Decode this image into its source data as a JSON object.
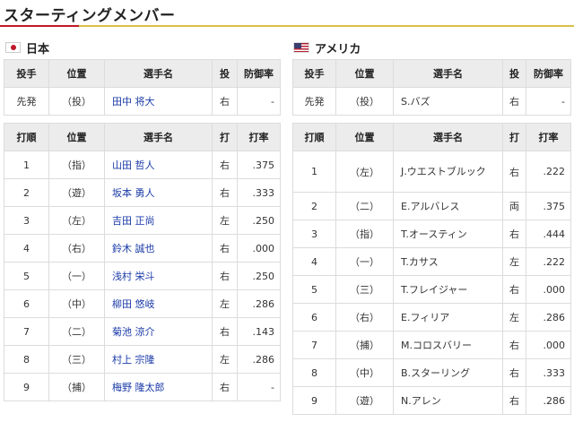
{
  "page": {
    "title": "スターティングメンバー"
  },
  "japan": {
    "team_name": "日本",
    "flag_icon": "japan-flag-icon",
    "pitcher_headers": [
      "投手",
      "位置",
      "選手名",
      "投",
      "防御率"
    ],
    "pitcher": {
      "role": "先発",
      "pos": "（投）",
      "name": "田中 将大",
      "hand": "右",
      "era": "-"
    },
    "batting_headers": [
      "打順",
      "位置",
      "選手名",
      "打",
      "打率"
    ],
    "batters": [
      {
        "order": "1",
        "pos": "（指）",
        "name": "山田 哲人",
        "hand": "右",
        "avg": ".375"
      },
      {
        "order": "2",
        "pos": "（遊）",
        "name": "坂本 勇人",
        "hand": "右",
        "avg": ".333"
      },
      {
        "order": "3",
        "pos": "（左）",
        "name": "吉田 正尚",
        "hand": "左",
        "avg": ".250"
      },
      {
        "order": "4",
        "pos": "（右）",
        "name": "鈴木 誠也",
        "hand": "右",
        "avg": ".000"
      },
      {
        "order": "5",
        "pos": "（一）",
        "name": "浅村 栄斗",
        "hand": "右",
        "avg": ".250"
      },
      {
        "order": "6",
        "pos": "（中）",
        "name": "柳田 悠岐",
        "hand": "左",
        "avg": ".286"
      },
      {
        "order": "7",
        "pos": "（二）",
        "name": "菊池 涼介",
        "hand": "右",
        "avg": ".143"
      },
      {
        "order": "8",
        "pos": "（三）",
        "name": "村上 宗隆",
        "hand": "左",
        "avg": ".286"
      },
      {
        "order": "9",
        "pos": "（捕）",
        "name": "梅野 隆太郎",
        "hand": "右",
        "avg": "-"
      }
    ]
  },
  "usa": {
    "team_name": "アメリカ",
    "flag_icon": "usa-flag-icon",
    "pitcher_headers": [
      "投手",
      "位置",
      "選手名",
      "投",
      "防御率"
    ],
    "pitcher": {
      "role": "先発",
      "pos": "（投）",
      "name": "S.バズ",
      "hand": "右",
      "era": "-"
    },
    "batting_headers": [
      "打順",
      "位置",
      "選手名",
      "打",
      "打率"
    ],
    "batters": [
      {
        "order": "1",
        "pos": "（左）",
        "name": "J.ウエストブルック",
        "hand": "右",
        "avg": ".222"
      },
      {
        "order": "2",
        "pos": "（二）",
        "name": "E.アルバレス",
        "hand": "両",
        "avg": ".375"
      },
      {
        "order": "3",
        "pos": "（指）",
        "name": "T.オースティン",
        "hand": "右",
        "avg": ".444"
      },
      {
        "order": "4",
        "pos": "（一）",
        "name": "T.カサス",
        "hand": "左",
        "avg": ".222"
      },
      {
        "order": "5",
        "pos": "（三）",
        "name": "T.フレイジャー",
        "hand": "右",
        "avg": ".000"
      },
      {
        "order": "6",
        "pos": "（右）",
        "name": "E.フィリア",
        "hand": "左",
        "avg": ".286"
      },
      {
        "order": "7",
        "pos": "（捕）",
        "name": "M.コロスバリー",
        "hand": "右",
        "avg": ".000"
      },
      {
        "order": "8",
        "pos": "（中）",
        "name": "B.スターリング",
        "hand": "右",
        "avg": ".333"
      },
      {
        "order": "9",
        "pos": "（遊）",
        "name": "N.アレン",
        "hand": "右",
        "avg": ".286"
      }
    ]
  },
  "colors": {
    "accent_red": "#c0182a",
    "rule_gold": "#d8c14a",
    "link_blue": "#1a3aa8",
    "header_gray": "#ececec"
  }
}
